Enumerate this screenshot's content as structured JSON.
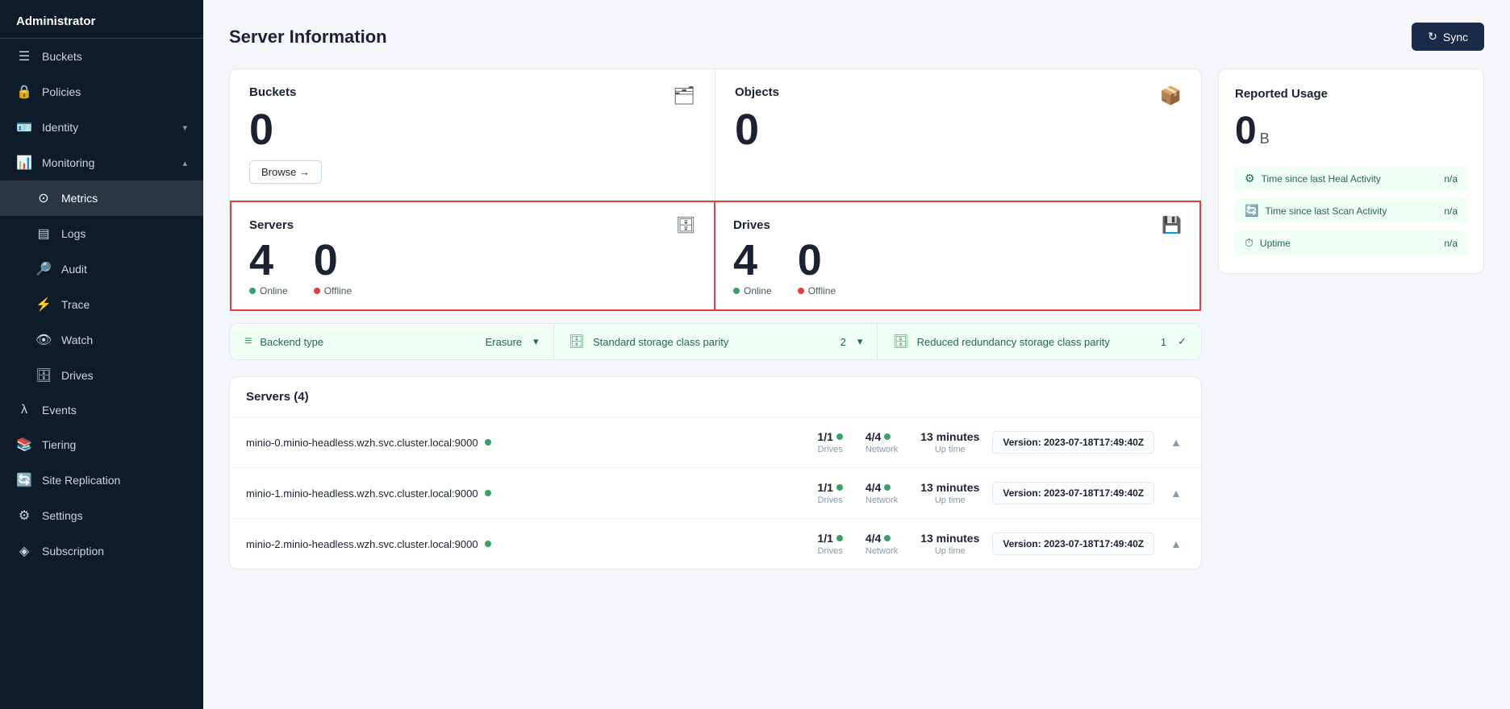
{
  "sidebar": {
    "admin_label": "Administrator",
    "items": [
      {
        "id": "buckets",
        "label": "Buckets",
        "icon": "☰",
        "active": false
      },
      {
        "id": "policies",
        "label": "Policies",
        "icon": "🔒",
        "active": false
      },
      {
        "id": "identity",
        "label": "Identity",
        "icon": "🪪",
        "active": false,
        "has_chevron": true
      },
      {
        "id": "monitoring",
        "label": "Monitoring",
        "icon": "📊",
        "active": false,
        "has_chevron": true,
        "expanded": true
      },
      {
        "id": "metrics",
        "label": "Metrics",
        "icon": "⊙",
        "active": true,
        "indent": true
      },
      {
        "id": "logs",
        "label": "Logs",
        "icon": "▤",
        "active": false,
        "indent": true
      },
      {
        "id": "audit",
        "label": "Audit",
        "icon": "🔎",
        "active": false,
        "indent": true
      },
      {
        "id": "trace",
        "label": "Trace",
        "icon": "⚡",
        "active": false,
        "indent": true
      },
      {
        "id": "watch",
        "label": "Watch",
        "icon": "👁",
        "active": false,
        "indent": true
      },
      {
        "id": "drives",
        "label": "Drives",
        "icon": "🗄",
        "active": false,
        "indent": true
      },
      {
        "id": "events",
        "label": "Events",
        "icon": "λ",
        "active": false
      },
      {
        "id": "tiering",
        "label": "Tiering",
        "icon": "📚",
        "active": false
      },
      {
        "id": "site-replication",
        "label": "Site Replication",
        "icon": "🔄",
        "active": false
      },
      {
        "id": "settings",
        "label": "Settings",
        "icon": "⚙",
        "active": false
      },
      {
        "id": "subscription",
        "label": "Subscription",
        "icon": "",
        "active": false
      }
    ]
  },
  "page": {
    "title": "Server Information",
    "sync_button": "Sync"
  },
  "stats": {
    "buckets": {
      "label": "Buckets",
      "value": "0",
      "browse_label": "Browse →"
    },
    "objects": {
      "label": "Objects",
      "value": "0"
    },
    "servers": {
      "label": "Servers",
      "online_value": "4",
      "online_label": "Online",
      "offline_value": "0",
      "offline_label": "Offline"
    },
    "drives": {
      "label": "Drives",
      "online_value": "4",
      "online_label": "Online",
      "offline_value": "0",
      "offline_label": "Offline"
    }
  },
  "reported_usage": {
    "title": "Reported Usage",
    "value": "0",
    "unit": "B",
    "rows": [
      {
        "label": "Time since last Heal Activity",
        "value": "n/a"
      },
      {
        "label": "Time since last Scan Activity",
        "value": "n/a"
      },
      {
        "label": "Uptime",
        "value": "n/a"
      }
    ]
  },
  "info_bar": [
    {
      "label": "Backend type",
      "value": "Erasure",
      "icon": "≡"
    },
    {
      "label": "Standard storage class parity",
      "value": "2",
      "icon": "🗄"
    },
    {
      "label": "Reduced redundancy storage class parity",
      "value": "1",
      "icon": "🗄"
    }
  ],
  "servers_section": {
    "title": "Servers",
    "count": "4",
    "servers": [
      {
        "name": "minio-0.minio-headless.wzh.svc.cluster.local:9000",
        "online": true,
        "drives": "1/1",
        "network": "4/4",
        "uptime": "13 minutes",
        "version": "2023-07-18T17:49:40Z"
      },
      {
        "name": "minio-1.minio-headless.wzh.svc.cluster.local:9000",
        "online": true,
        "drives": "1/1",
        "network": "4/4",
        "uptime": "13 minutes",
        "version": "2023-07-18T17:49:40Z"
      },
      {
        "name": "minio-2.minio-headless.wzh.svc.cluster.local:9000",
        "online": true,
        "drives": "1/1",
        "network": "4/4",
        "uptime": "13 minutes",
        "version": "2023-07-18T17:49:40Z"
      }
    ]
  }
}
